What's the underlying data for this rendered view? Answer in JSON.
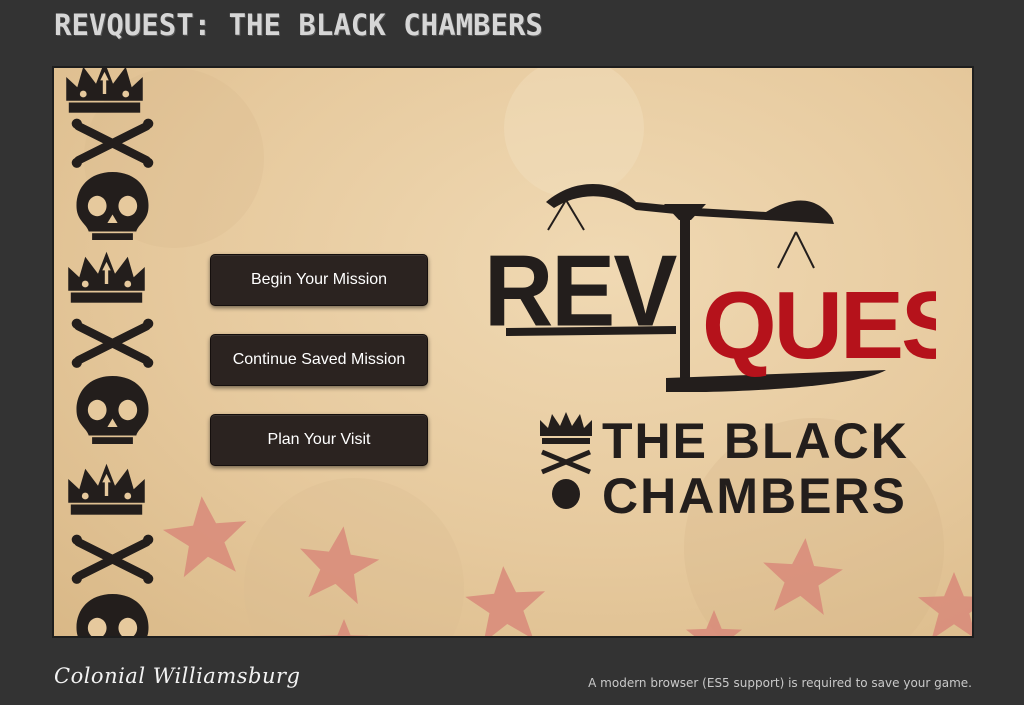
{
  "page": {
    "title": "REVQUEST: THE BLACK CHAMBERS"
  },
  "menu": {
    "items": [
      {
        "label": "Begin Your Mission"
      },
      {
        "label": "Continue Saved Mission"
      },
      {
        "label": "Plan Your Visit"
      }
    ]
  },
  "logo": {
    "word_rev": "REV",
    "word_quest": "QUEST",
    "line1": "THE BLACK",
    "line2": "CHAMBERS"
  },
  "footer": {
    "brand": "Colonial Williamsburg",
    "browser_note": "A modern browser (ES5 support) is required to save your game."
  },
  "colors": {
    "background": "#333333",
    "parchment": "#e6c99d",
    "button": "#2b2320",
    "ink": "#231e1c",
    "brand_red": "#b5121b",
    "star": "#d98a7a"
  }
}
